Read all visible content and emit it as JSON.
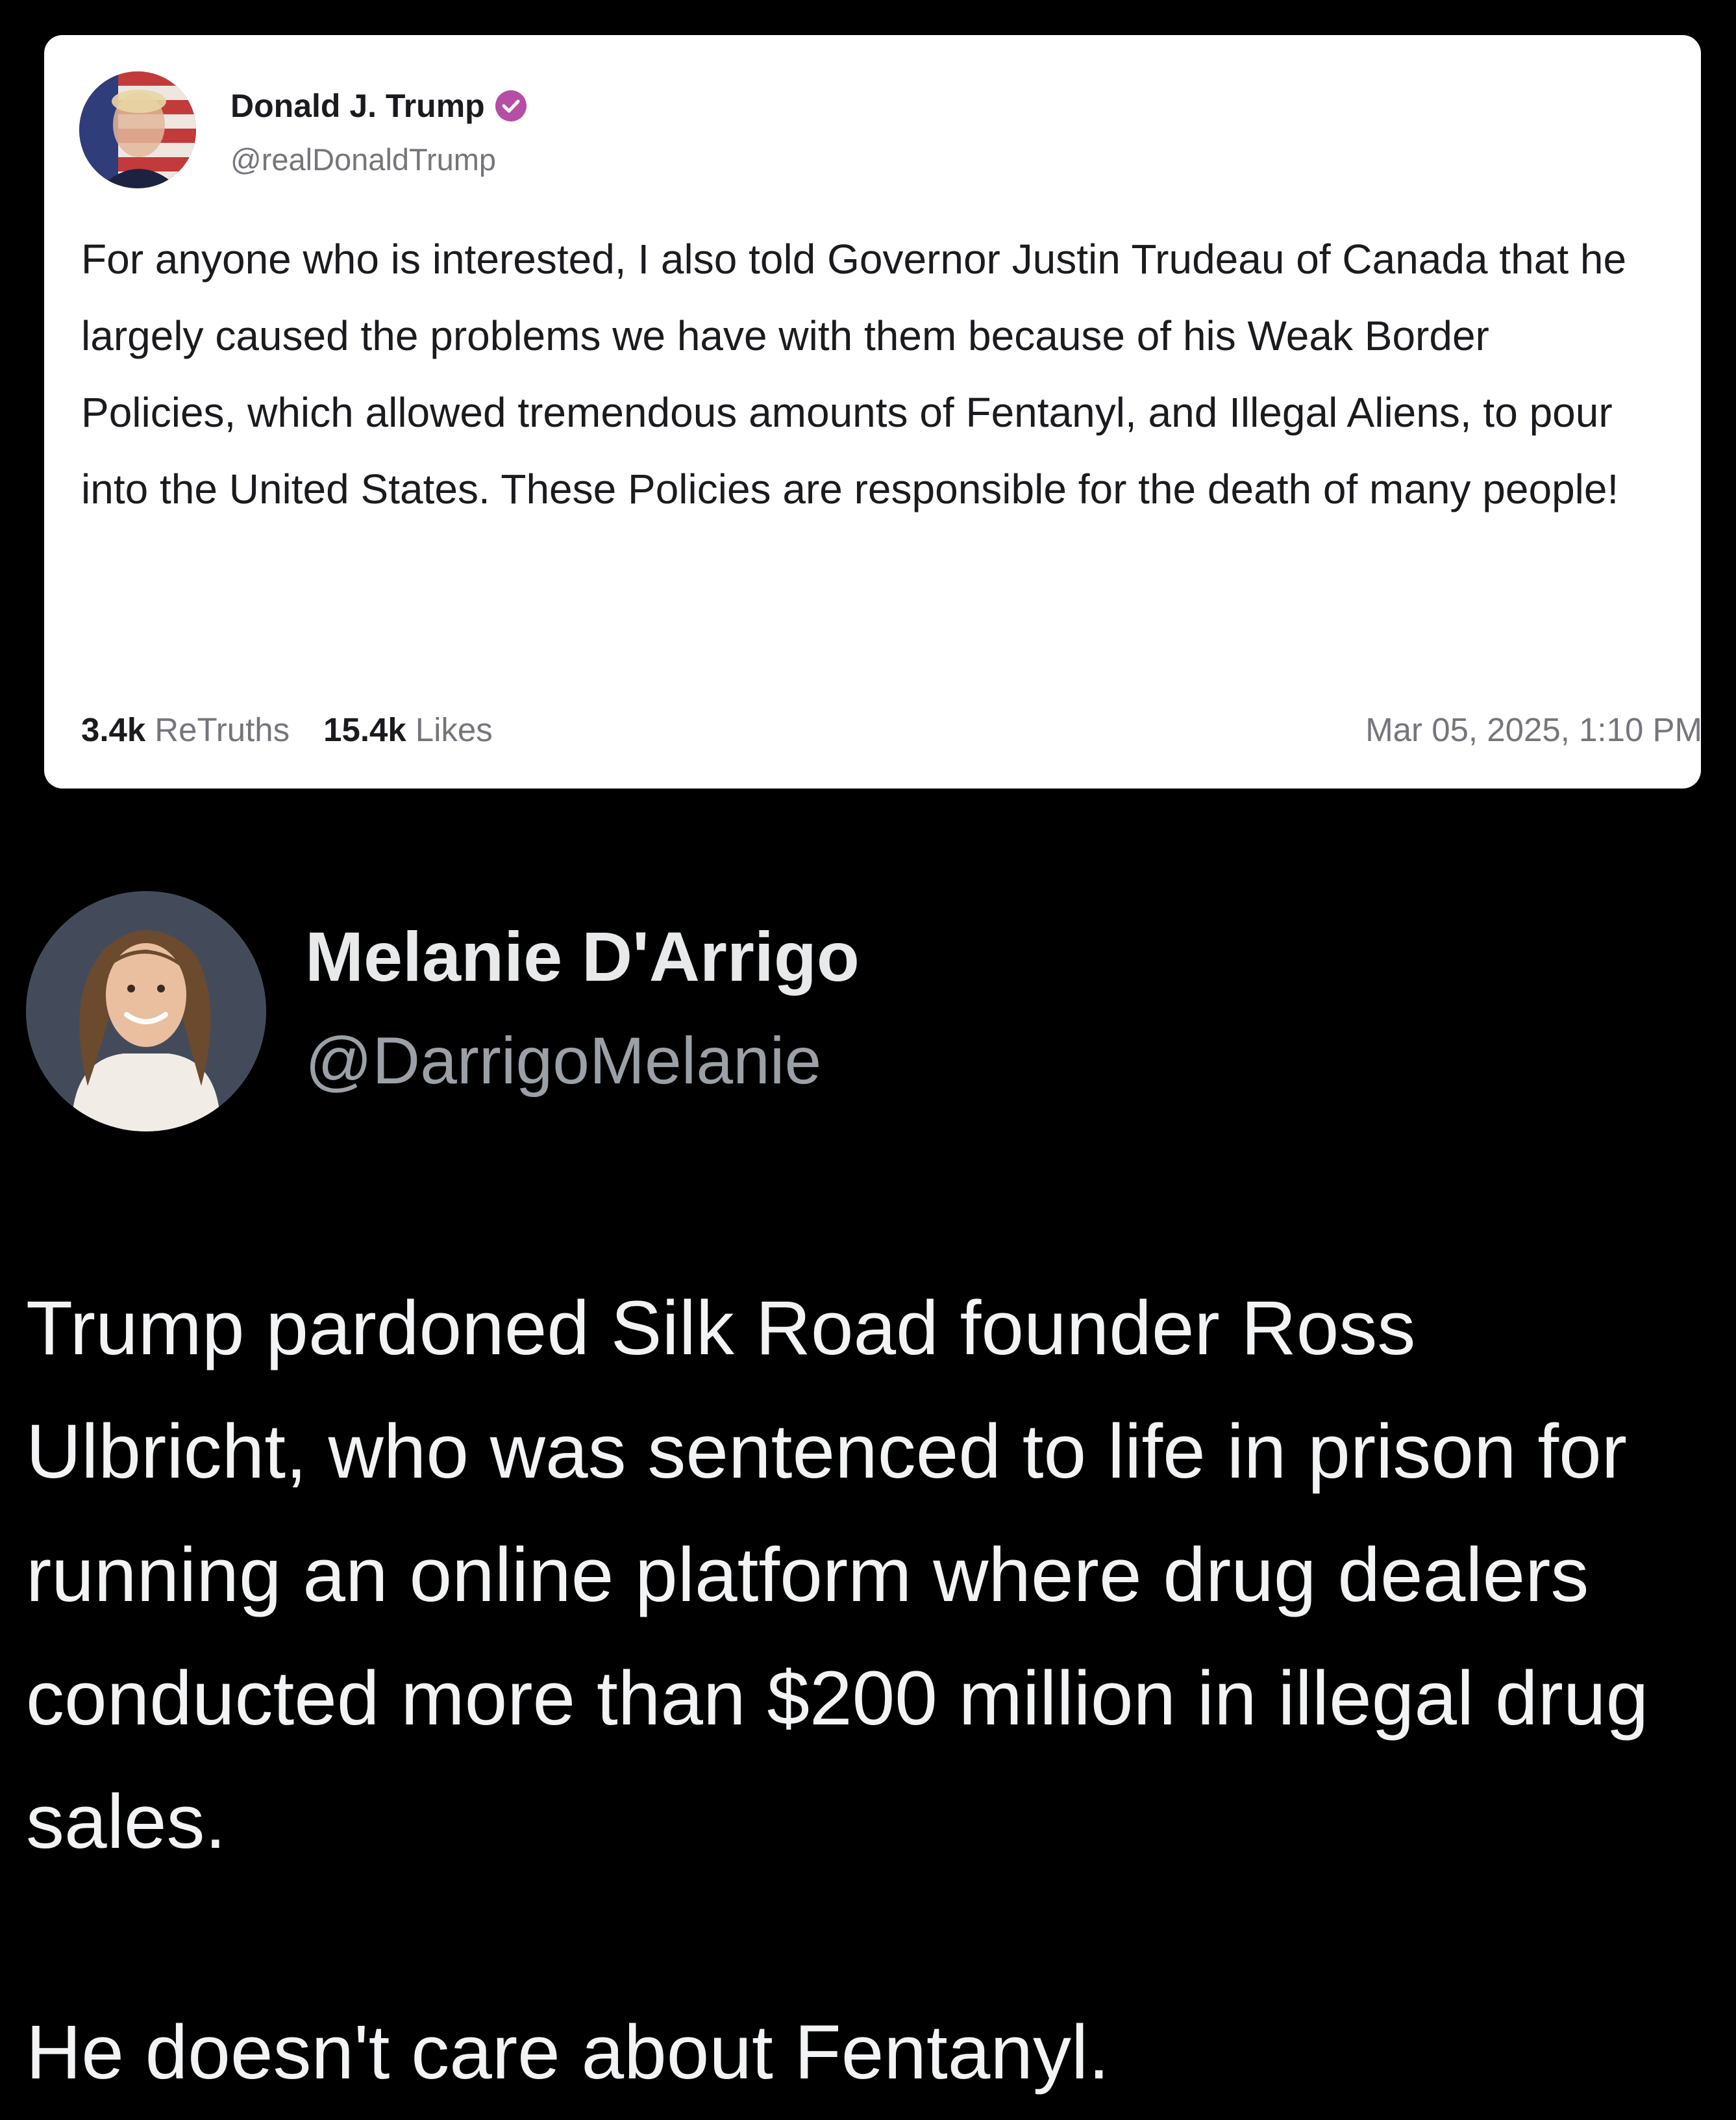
{
  "truth_post": {
    "author_name": "Donald J. Trump",
    "handle": "@realDonaldTrump",
    "verified_icon": "verified-badge-icon",
    "avatar_icon": "profile-avatar",
    "body": "For anyone who is interested, I also told Governor Justin Trudeau of Canada that he largely caused the problems we have with them because of his Weak Border Policies, which allowed tremendous amounts of Fentanyl, and Illegal Aliens, to pour into the United States. These Policies are responsible for the death of many people!",
    "retruths_count": "3.4k",
    "retruths_label": "ReTruths",
    "likes_count": "15.4k",
    "likes_label": "Likes",
    "timestamp": "Mar 05, 2025, 1:10 PM",
    "colors": {
      "card_bg": "#ffffff",
      "verified": "#b54ea6",
      "muted": "#75757d"
    }
  },
  "tweet": {
    "author_name": "Melanie D'Arrigo",
    "handle": "@DarrigoMelanie",
    "avatar_icon": "profile-avatar",
    "body": "Trump pardoned Silk Road founder Ross Ulbricht, who was sentenced to life in prison for running an online platform where drug dealers conducted more than $200 million in illegal drug sales.",
    "closing_line": "He doesn't care about Fentanyl.",
    "colors": {
      "page_bg": "#000000",
      "text": "#f2f3f4",
      "handle": "#9aa0a6"
    }
  }
}
